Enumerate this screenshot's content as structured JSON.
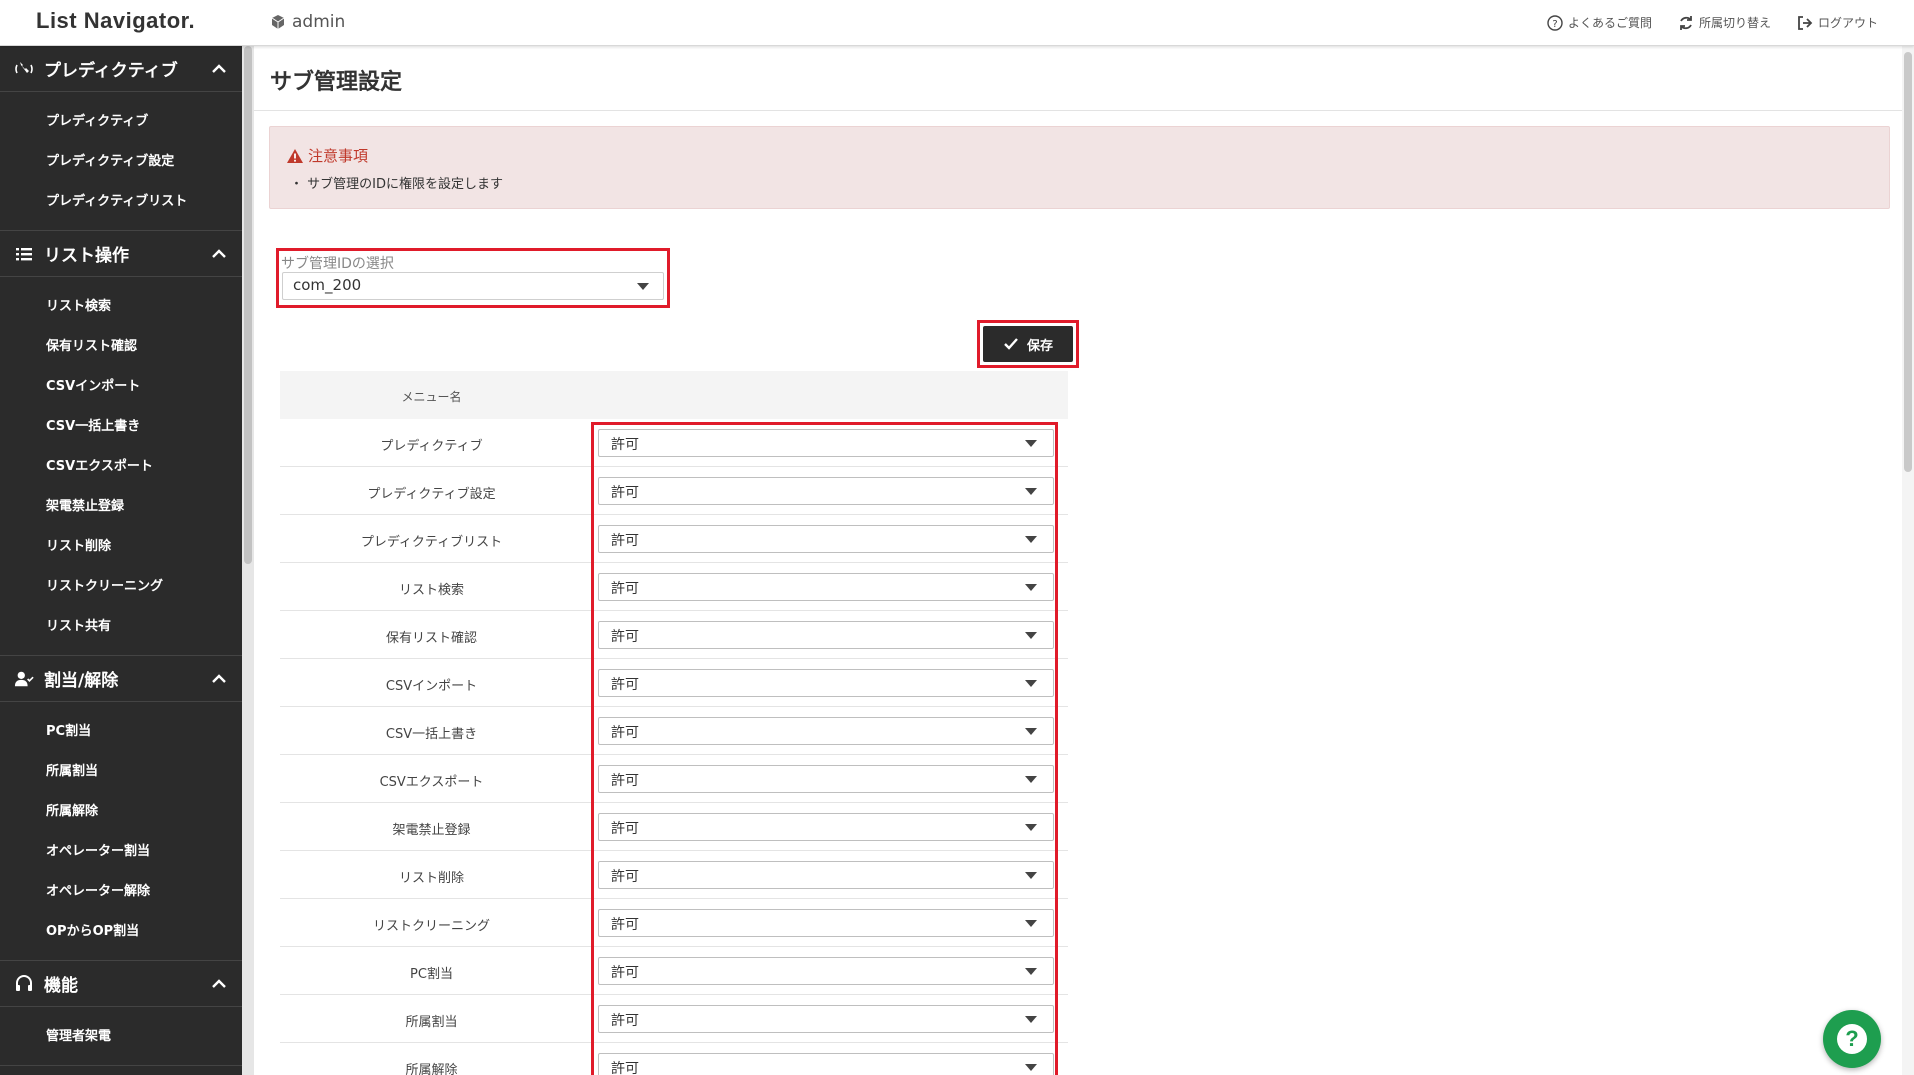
{
  "app": {
    "logo": "List Navigator.",
    "user": "admin"
  },
  "topnav": {
    "faq": "よくあるご質問",
    "switch_org": "所属切り替え",
    "logout": "ログアウト"
  },
  "sidebar": {
    "sections": [
      {
        "title": "プレディクティブ",
        "icon": "phone-wave-icon",
        "items": [
          "プレディクティブ",
          "プレディクティブ設定",
          "プレディクティブリスト"
        ]
      },
      {
        "title": "リスト操作",
        "icon": "list-icon",
        "items": [
          "リスト検索",
          "保有リスト確認",
          "CSVインポート",
          "CSV一括上書き",
          "CSVエクスポート",
          "架電禁止登録",
          "リスト削除",
          "リストクリーニング",
          "リスト共有"
        ]
      },
      {
        "title": "割当/解除",
        "icon": "user-check-icon",
        "items": [
          "PC割当",
          "所属割当",
          "所属解除",
          "オペレーター割当",
          "オペレーター解除",
          "OPからOP割当"
        ]
      },
      {
        "title": "機能",
        "icon": "headset-icon",
        "items": [
          "管理者架電"
        ]
      }
    ]
  },
  "page": {
    "title": "サブ管理設定",
    "notice": {
      "title": "注意事項",
      "body": "・ サブ管理のIDに権限を設定します"
    },
    "sub_id": {
      "label": "サブ管理IDの選択",
      "value": "com_200"
    },
    "save_label": "保存",
    "table": {
      "header": "メニュー名",
      "rows": [
        {
          "name": "プレディクティブ",
          "value": "許可"
        },
        {
          "name": "プレディクティブ設定",
          "value": "許可"
        },
        {
          "name": "プレディクティブリスト",
          "value": "許可"
        },
        {
          "name": "リスト検索",
          "value": "許可"
        },
        {
          "name": "保有リスト確認",
          "value": "許可"
        },
        {
          "name": "CSVインポート",
          "value": "許可"
        },
        {
          "name": "CSV一括上書き",
          "value": "許可"
        },
        {
          "name": "CSVエクスポート",
          "value": "許可"
        },
        {
          "name": "架電禁止登録",
          "value": "許可"
        },
        {
          "name": "リスト削除",
          "value": "許可"
        },
        {
          "name": "リストクリーニング",
          "value": "許可"
        },
        {
          "name": "PC割当",
          "value": "許可"
        },
        {
          "name": "所属割当",
          "value": "許可"
        },
        {
          "name": "所属解除",
          "value": "許可"
        }
      ]
    }
  },
  "colors": {
    "highlight": "#e01b2a",
    "sidebar": "#2b2b2b",
    "notice_bg": "#f2e4e4",
    "notice_text": "#c0392b",
    "help": "#1e9e4f"
  }
}
